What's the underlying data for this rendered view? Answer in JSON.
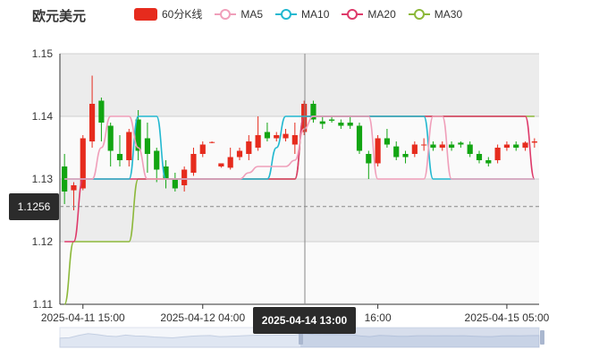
{
  "title": "欧元美元",
  "legend": [
    {
      "label": "60分K线",
      "kind": "bar",
      "color": "#e62b1d"
    },
    {
      "label": "MA5",
      "kind": "line",
      "color": "#f09fba"
    },
    {
      "label": "MA10",
      "kind": "line",
      "color": "#22b8d0"
    },
    {
      "label": "MA20",
      "kind": "line",
      "color": "#de3a6a"
    },
    {
      "label": "MA30",
      "kind": "line",
      "color": "#8cb83a"
    }
  ],
  "cursor": {
    "y_value": "1.1256",
    "x_value": "2025-04-14 13:00"
  },
  "colors": {
    "up": "#e62b1d",
    "down": "#12a512",
    "band": "#ececec",
    "axis": "#333333"
  },
  "chart_data": {
    "type": "candlestick",
    "y_ticks": [
      "1.15",
      "1.14",
      "1.13",
      "1.12",
      "1.11"
    ],
    "ylim": [
      1.11,
      1.15
    ],
    "x_ticks": [
      "2025-04-11 15:00",
      "2025-04-12 04:00",
      "16:00",
      "2025-04-15 05:00"
    ],
    "candles": [
      [
        1.132,
        1.128,
        1.134,
        1.126
      ],
      [
        1.1282,
        1.129,
        1.1295,
        1.125
      ],
      [
        1.1285,
        1.1365,
        1.137,
        1.1282
      ],
      [
        1.136,
        1.142,
        1.1465,
        1.135
      ],
      [
        1.1425,
        1.139,
        1.143,
        1.136
      ],
      [
        1.1385,
        1.1345,
        1.139,
        1.132
      ],
      [
        1.134,
        1.133,
        1.137,
        1.132
      ],
      [
        1.133,
        1.1375,
        1.138,
        1.132
      ],
      [
        1.1395,
        1.1345,
        1.141,
        1.133
      ],
      [
        1.1365,
        1.134,
        1.139,
        1.131
      ],
      [
        1.1345,
        1.1315,
        1.135,
        1.1295
      ],
      [
        1.132,
        1.13,
        1.133,
        1.1285
      ],
      [
        1.13,
        1.1285,
        1.131,
        1.128
      ],
      [
        1.129,
        1.1315,
        1.132,
        1.128
      ],
      [
        1.131,
        1.134,
        1.135,
        1.1305
      ],
      [
        1.134,
        1.1355,
        1.136,
        1.1335
      ],
      [
        1.1358,
        1.1359,
        1.136,
        1.1357
      ],
      [
        1.132,
        1.1325,
        1.1325,
        1.1318
      ],
      [
        1.1318,
        1.1335,
        1.135,
        1.1315
      ],
      [
        1.1335,
        1.1345,
        1.135,
        1.133
      ],
      [
        1.134,
        1.136,
        1.137,
        1.133
      ],
      [
        1.135,
        1.137,
        1.14,
        1.1345
      ],
      [
        1.1375,
        1.1365,
        1.139,
        1.136
      ],
      [
        1.1365,
        1.137,
        1.1375,
        1.136
      ],
      [
        1.1365,
        1.1372,
        1.138,
        1.136
      ],
      [
        1.1355,
        1.137,
        1.139,
        1.134
      ],
      [
        1.1375,
        1.142,
        1.1425,
        1.137
      ],
      [
        1.142,
        1.1395,
        1.1425,
        1.139
      ],
      [
        1.1392,
        1.1388,
        1.14,
        1.138
      ],
      [
        1.1395,
        1.1393,
        1.14,
        1.139
      ],
      [
        1.139,
        1.1385,
        1.1395,
        1.138
      ],
      [
        1.139,
        1.1385,
        1.14,
        1.138
      ],
      [
        1.1385,
        1.1345,
        1.139,
        1.134
      ],
      [
        1.134,
        1.1325,
        1.1345,
        1.13
      ],
      [
        1.1325,
        1.1365,
        1.137,
        1.132
      ],
      [
        1.1365,
        1.1355,
        1.138,
        1.135
      ],
      [
        1.1352,
        1.1335,
        1.136,
        1.133
      ],
      [
        1.134,
        1.1335,
        1.1345,
        1.1325
      ],
      [
        1.134,
        1.1355,
        1.136,
        1.1335
      ],
      [
        1.1355,
        1.1355,
        1.1365,
        1.1345
      ],
      [
        1.1355,
        1.135,
        1.136,
        1.1345
      ],
      [
        1.135,
        1.1355,
        1.136,
        1.1345
      ],
      [
        1.1355,
        1.135,
        1.136,
        1.1345
      ],
      [
        1.1358,
        1.1355,
        1.136,
        1.135
      ],
      [
        1.1355,
        1.134,
        1.136,
        1.1335
      ],
      [
        1.134,
        1.133,
        1.1345,
        1.1325
      ],
      [
        1.133,
        1.1325,
        1.1335,
        1.132
      ],
      [
        1.133,
        1.135,
        1.1355,
        1.1325
      ],
      [
        1.135,
        1.1355,
        1.136,
        1.1345
      ],
      [
        1.1355,
        1.135,
        1.136,
        1.1345
      ],
      [
        1.135,
        1.1358,
        1.136,
        1.1345
      ],
      [
        1.1358,
        1.136,
        1.1365,
        1.135
      ]
    ],
    "ma5": [
      1.13,
      1.13,
      1.13,
      1.13,
      1.135,
      1.14,
      1.14,
      1.14,
      1.135,
      1.13,
      1.13,
      1.13,
      1.13,
      1.13,
      1.13,
      1.13,
      1.13,
      1.13,
      1.13,
      1.13,
      1.131,
      1.132,
      1.132,
      1.132,
      1.132,
      1.133,
      1.138,
      1.14,
      1.14,
      1.14,
      1.14,
      1.14,
      1.14,
      1.14,
      1.13,
      1.13,
      1.13,
      1.13,
      1.13,
      1.13,
      1.14,
      1.14,
      1.13,
      1.13,
      1.13,
      1.13,
      1.13,
      1.13,
      1.13,
      1.13,
      1.13,
      1.13
    ],
    "ma10": [
      1.13,
      1.13,
      1.13,
      1.13,
      1.13,
      1.13,
      1.13,
      1.13,
      1.14,
      1.14,
      1.14,
      1.13,
      1.13,
      1.13,
      1.13,
      1.13,
      1.13,
      1.13,
      1.13,
      1.13,
      1.13,
      1.13,
      1.13,
      1.135,
      1.14,
      1.14,
      1.14,
      1.14,
      1.14,
      1.14,
      1.14,
      1.14,
      1.14,
      1.14,
      1.14,
      1.14,
      1.14,
      1.14,
      1.14,
      1.14,
      1.13,
      1.13,
      1.13,
      1.13,
      1.13,
      1.13,
      1.13,
      1.13,
      1.13,
      1.13,
      1.13,
      1.13
    ],
    "ma20": [
      1.12,
      1.12,
      1.13,
      1.13,
      1.13,
      1.13,
      1.13,
      1.13,
      1.13,
      1.13,
      1.13,
      1.13,
      1.13,
      1.13,
      1.13,
      1.13,
      1.13,
      1.13,
      1.13,
      1.13,
      1.13,
      1.13,
      1.13,
      1.13,
      1.13,
      1.13,
      1.14,
      1.14,
      1.14,
      1.14,
      1.14,
      1.14,
      1.14,
      1.14,
      1.14,
      1.14,
      1.14,
      1.14,
      1.14,
      1.14,
      1.14,
      1.14,
      1.14,
      1.14,
      1.14,
      1.14,
      1.14,
      1.14,
      1.14,
      1.14,
      1.14,
      1.13
    ],
    "ma30": [
      1.11,
      1.12,
      1.12,
      1.12,
      1.12,
      1.12,
      1.12,
      1.12,
      1.13,
      1.13,
      1.13,
      1.13,
      1.13,
      1.13,
      1.13,
      1.13,
      1.13,
      1.13,
      1.13,
      1.13,
      1.13,
      1.13,
      1.13,
      1.13,
      1.13,
      1.13,
      1.14,
      1.14,
      1.14,
      1.14,
      1.14,
      1.14,
      1.14,
      1.14,
      1.14,
      1.14,
      1.14,
      1.14,
      1.14,
      1.14,
      1.14,
      1.14,
      1.14,
      1.14,
      1.14,
      1.14,
      1.14,
      1.14,
      1.14,
      1.14,
      1.14,
      1.14
    ]
  }
}
